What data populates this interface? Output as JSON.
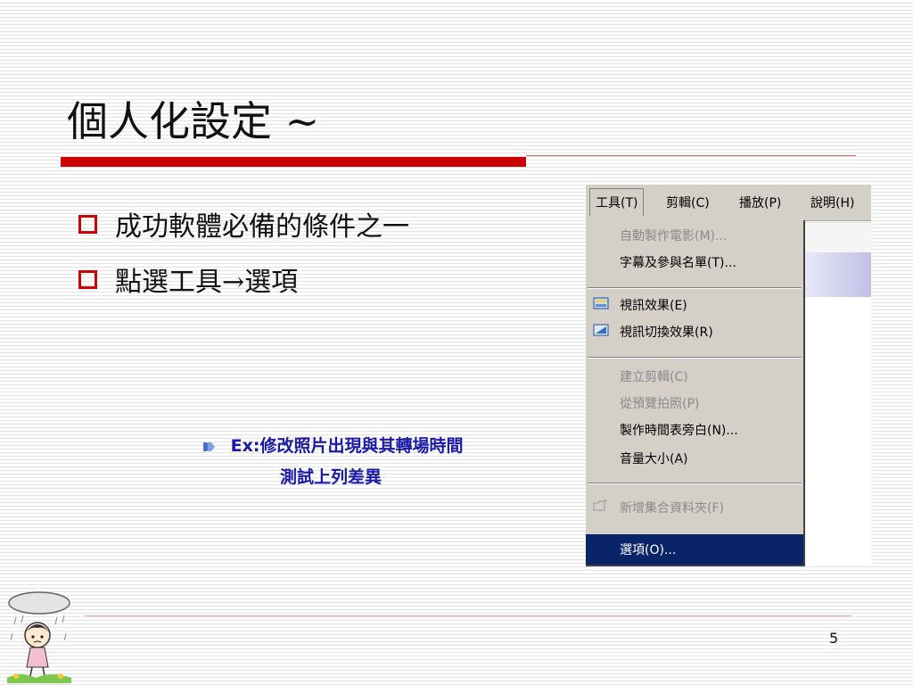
{
  "slide": {
    "title": "個人化設定 ~",
    "bullets": [
      {
        "text": "成功軟體必備的條件之一"
      },
      {
        "text": "點選工具→選項"
      }
    ],
    "sub_note": {
      "line1": "Ex:修改照片出現與其轉場時間",
      "line2": "測試上列差異"
    },
    "page_number": "5"
  },
  "menubar": {
    "items": [
      {
        "label": "工具(T)",
        "active": true
      },
      {
        "label": "剪輯(C)"
      },
      {
        "label": "播放(P)"
      },
      {
        "label": "說明(H)"
      }
    ]
  },
  "dropdown": {
    "items": [
      {
        "label": "自動製作電影(M)...",
        "disabled": true
      },
      {
        "label": "字幕及參與名單(T)...",
        "disabled": false
      },
      {
        "label": "視訊效果(E)",
        "disabled": false,
        "icon": "video-effects-icon"
      },
      {
        "label": "視訊切換效果(R)",
        "disabled": false,
        "icon": "video-transitions-icon"
      },
      {
        "label": "建立剪輯(C)",
        "disabled": true
      },
      {
        "label": "從預覽拍照(P)",
        "disabled": true
      },
      {
        "label": "製作時間表旁白(N)...",
        "disabled": false
      },
      {
        "label": "音量大小(A)",
        "disabled": false
      },
      {
        "label": "新增集合資料夾(F)",
        "disabled": true,
        "icon": "new-folder-icon"
      },
      {
        "label": "選項(O)...",
        "disabled": false,
        "selected": true
      }
    ]
  },
  "colors": {
    "accent_red": "#cc0000",
    "sub_text_blue": "#1a1aa6",
    "menu_bg": "#d4d0c8",
    "highlight": "#0a246a"
  }
}
